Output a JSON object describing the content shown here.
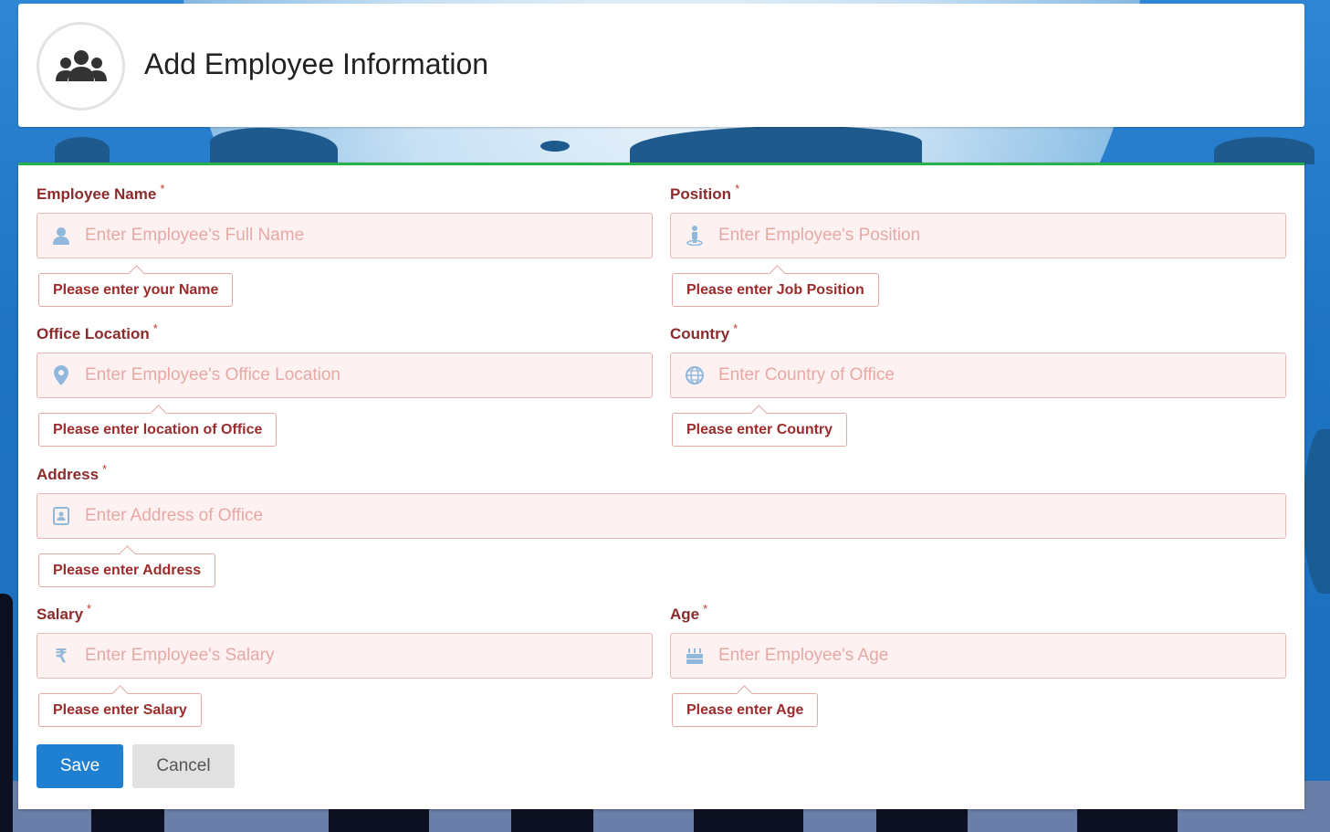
{
  "header": {
    "title": "Add Employee Information",
    "icon": "users-group-icon"
  },
  "form": {
    "fields": [
      {
        "key": "name",
        "label": "Employee Name",
        "required": "*",
        "placeholder": "Enter Employee's Full Name",
        "value": "",
        "icon": "user-icon",
        "error": "Please enter your Name"
      },
      {
        "key": "position",
        "label": "Position",
        "required": "*",
        "placeholder": "Enter Employee's Position",
        "value": "",
        "icon": "position-icon",
        "error": "Please enter Job Position"
      },
      {
        "key": "office",
        "label": "Office Location",
        "required": "*",
        "placeholder": "Enter Employee's Office Location",
        "value": "",
        "icon": "map-marker-icon",
        "error": "Please enter location of Office"
      },
      {
        "key": "country",
        "label": "Country",
        "required": "*",
        "placeholder": "Enter Country of Office",
        "value": "",
        "icon": "globe-icon",
        "error": "Please enter Country"
      },
      {
        "key": "address",
        "label": "Address",
        "required": "*",
        "placeholder": "Enter Address of Office",
        "value": "",
        "icon": "address-book-icon",
        "error": "Please enter Address"
      },
      {
        "key": "salary",
        "label": "Salary",
        "required": "*",
        "placeholder": "Enter Employee's Salary",
        "value": "",
        "icon": "rupee-icon",
        "error": "Please enter Salary"
      },
      {
        "key": "age",
        "label": "Age",
        "required": "*",
        "placeholder": "Enter Employee's Age",
        "value": "",
        "icon": "birthday-cake-icon",
        "error": "Please enter Age"
      }
    ],
    "buttons": {
      "save": "Save",
      "cancel": "Cancel"
    }
  },
  "colors": {
    "accent": "#1f7fd1",
    "label": "#8b2b2b",
    "error_text": "#9c2c2c",
    "input_bg": "#fdf2f1",
    "input_border": "#e8b8b5",
    "placeholder": "#e8a9a5",
    "icon": "#8fb8dc",
    "top_border": "#28b04a"
  }
}
